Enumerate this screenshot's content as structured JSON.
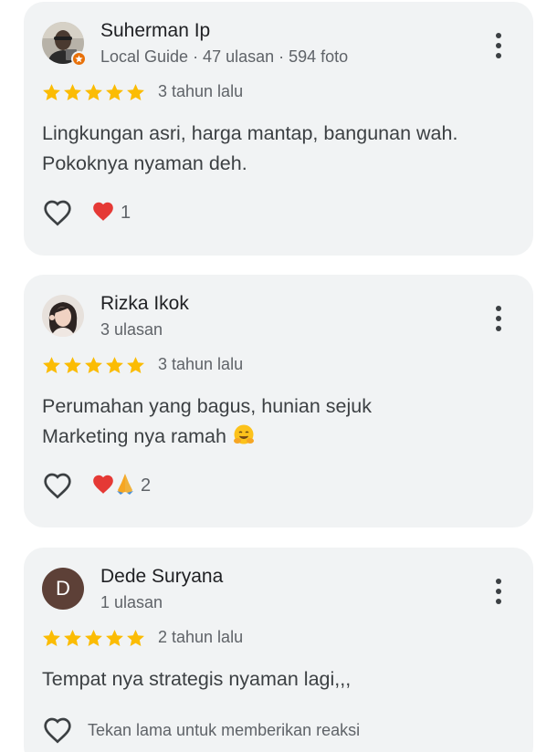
{
  "reviews": [
    {
      "name": "Suherman Ip",
      "meta": "Local Guide · 47 ulasan · 594 foto",
      "avatar_type": "photo",
      "local_guide": true,
      "rating": 5,
      "when": "3 tahun lalu",
      "text_lines": [
        "Lingkungan asri, harga mantap, bangunan wah.",
        "Pokoknya nyaman deh."
      ],
      "reactions": [
        "red-heart"
      ],
      "reaction_count": "1"
    },
    {
      "name": "Rizka Ikok",
      "meta": "3 ulasan",
      "avatar_type": "photo",
      "local_guide": false,
      "rating": 5,
      "when": "3 tahun lalu",
      "text_lines": [
        "Perumahan yang bagus, hunian sejuk",
        "Marketing nya ramah"
      ],
      "reactions": [
        "red-heart",
        "folded-hands"
      ],
      "reaction_count": "2"
    },
    {
      "name": "Dede Suryana",
      "meta": "1 ulasan",
      "avatar_type": "letter",
      "avatar_letter": "D",
      "avatar_color": "#5d4037",
      "local_guide": false,
      "rating": 5,
      "when": "2 tahun lalu",
      "text_lines": [
        "Tempat nya strategis nyaman lagi,,,"
      ],
      "reactions": [],
      "reaction_hint": "Tekan lama untuk memberikan reaksi"
    }
  ],
  "colors": {
    "card_bg": "#f1f3f4",
    "star": "#fbbc04",
    "secondary_text": "#5f6368",
    "local_guide_badge": "#e8710a"
  }
}
